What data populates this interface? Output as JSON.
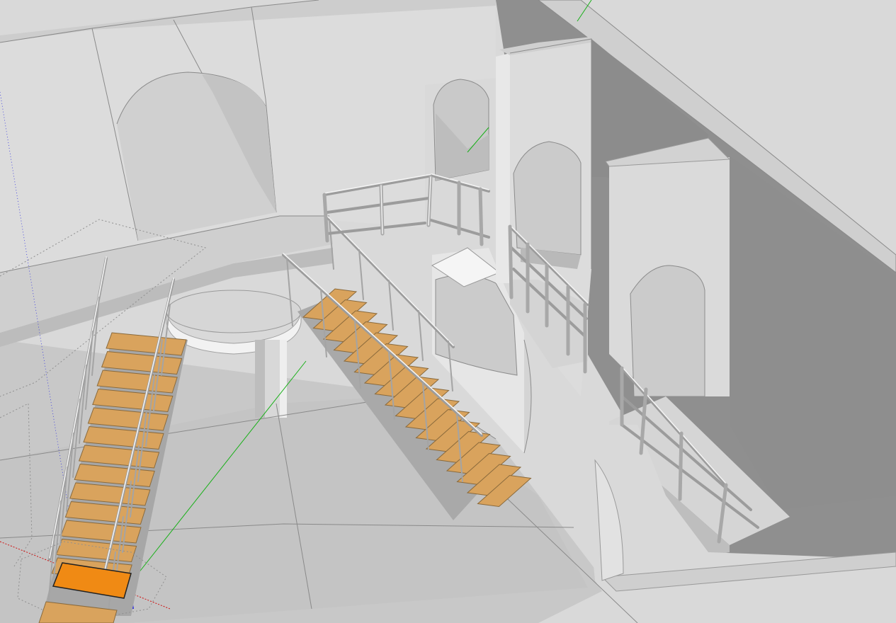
{
  "app": {
    "window_title": ""
  },
  "scene": {
    "description_visible_text": "",
    "colors": {
      "wall_light": "#dedede",
      "wall_mid": "#cfcfcf",
      "wall_shade": "#8e8e8e",
      "floor": "#c9c9c9",
      "tread": "#d9a35d",
      "tread_selected": "#f08a14",
      "axis_red": "#d01010",
      "axis_green": "#10b010",
      "axis_blue": "#1010d0"
    }
  }
}
